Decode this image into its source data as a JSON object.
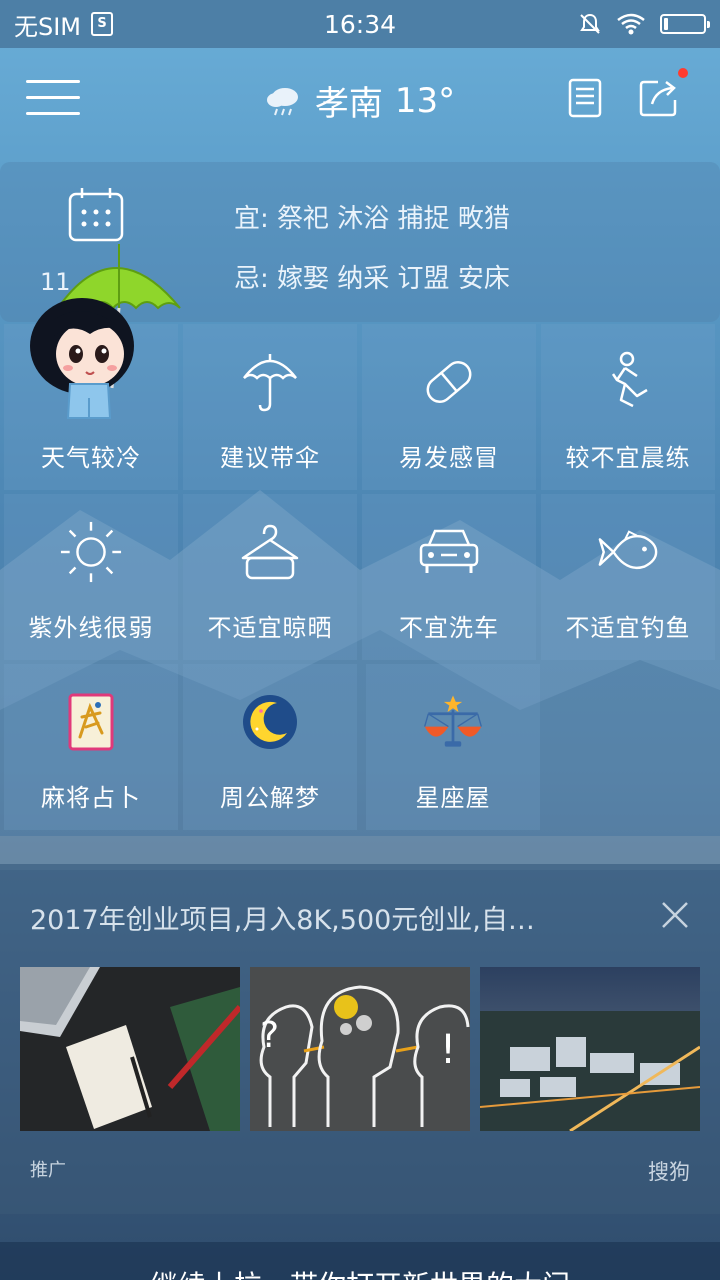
{
  "status_bar": {
    "carrier": "无SIM",
    "sim_icon": "S",
    "time": "16:34"
  },
  "header": {
    "weather_icon": "cloud-rain-icon",
    "city": "孝南",
    "temperature": "13°"
  },
  "almanac": {
    "date_fragment": "11",
    "yi": "宜: 祭祀 沐浴 捕捉 畋猎",
    "ji": "忌: 嫁娶 纳采 订盟 安床"
  },
  "tiles": [
    {
      "label": "天气较冷",
      "icon": "cold-weather-icon"
    },
    {
      "label": "建议带伞",
      "icon": "umbrella-icon"
    },
    {
      "label": "易发感冒",
      "icon": "pill-icon"
    },
    {
      "label": "较不宜晨练",
      "icon": "running-icon"
    },
    {
      "label": "紫外线很弱",
      "icon": "sun-icon"
    },
    {
      "label": "不适宜晾晒",
      "icon": "hanger-icon"
    },
    {
      "label": "不宜洗车",
      "icon": "car-icon"
    },
    {
      "label": "不适宜钓鱼",
      "icon": "fish-icon"
    },
    {
      "label": "麻将占卜",
      "icon": "mahjong-icon"
    },
    {
      "label": "周公解梦",
      "icon": "moon-icon"
    },
    {
      "label": "星座屋",
      "icon": "libra-icon"
    }
  ],
  "ad": {
    "headline": "2017年创业项目,月入8K,500元创业,自…",
    "tag": "推广",
    "source": "搜狗",
    "images": [
      "laptop-desk-image",
      "thinking-heads-image",
      "city-aerial-image"
    ]
  },
  "footer": {
    "text": "继续上拉，带你打开新世界的大门"
  }
}
